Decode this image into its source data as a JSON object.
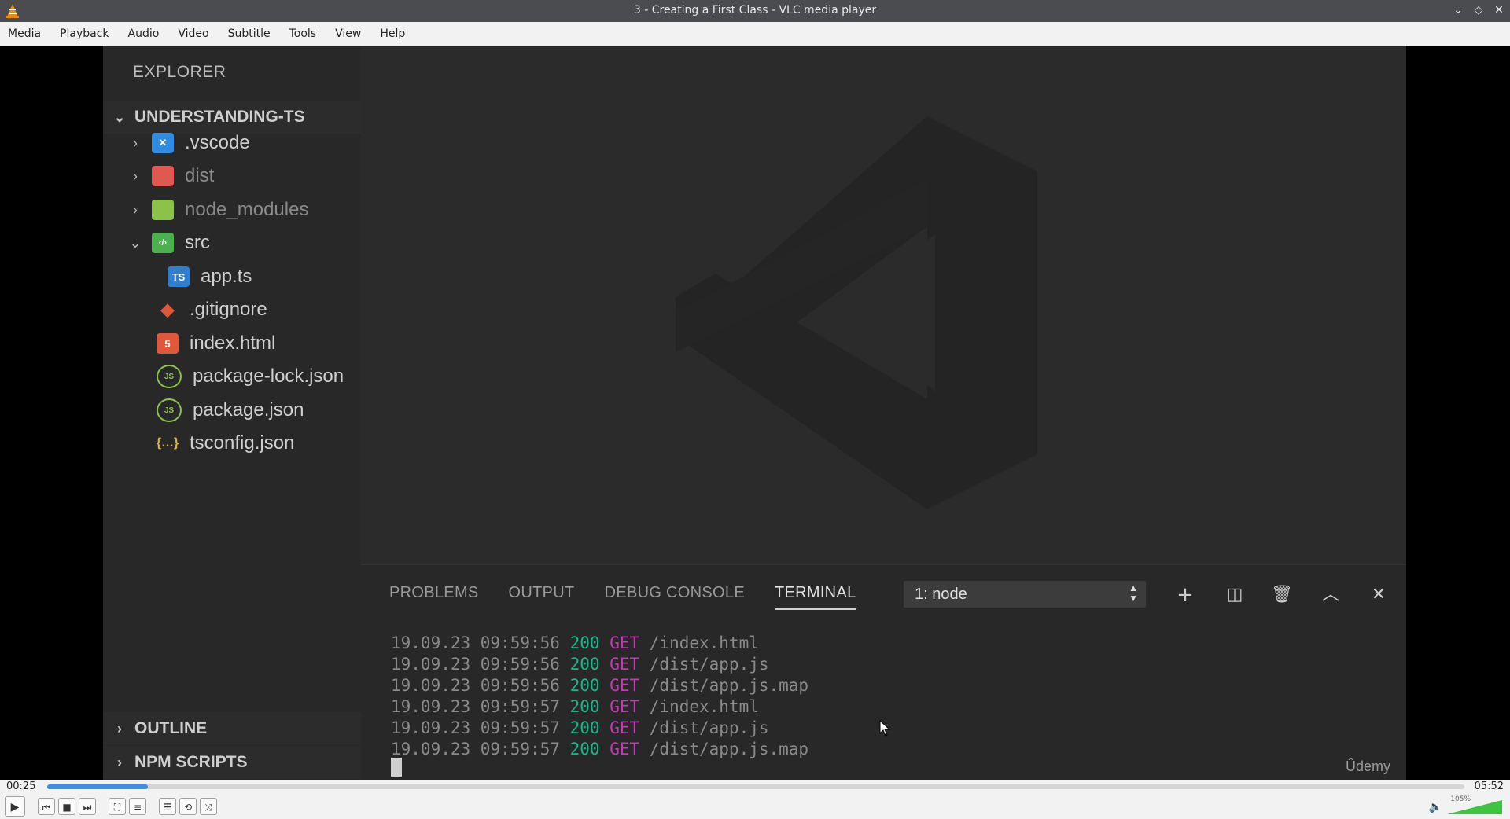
{
  "window": {
    "title": "3 - Creating a First Class - VLC media player"
  },
  "menu": [
    "Media",
    "Playback",
    "Audio",
    "Video",
    "Subtitle",
    "Tools",
    "View",
    "Help"
  ],
  "explorer": {
    "header": "EXPLORER",
    "project": "UNDERSTANDING-TS",
    "items": [
      {
        "label": ".vscode",
        "icon": "vscode-folder-icon",
        "color": "#2f8ce0",
        "glyph": "✕"
      },
      {
        "label": "dist",
        "icon": "dist-folder-icon",
        "color": "#e0584f",
        "glyph": ""
      },
      {
        "label": "node_modules",
        "icon": "node-folder-icon",
        "color": "#8bc34a",
        "glyph": ""
      },
      {
        "label": "src",
        "icon": "src-folder-icon",
        "color": "#4caf50",
        "glyph": "‹/›"
      },
      {
        "label": "app.ts",
        "icon": "typescript-file-icon",
        "color": "#2f7fd1",
        "glyph": "TS"
      },
      {
        "label": ".gitignore",
        "icon": "git-file-icon",
        "color": "#e0583a",
        "glyph": "◆"
      },
      {
        "label": "index.html",
        "icon": "html-file-icon",
        "color": "#e0583a",
        "glyph": "5"
      },
      {
        "label": "package-lock.json",
        "icon": "nodejs-file-icon",
        "color": "#8bc34a",
        "glyph": "JS"
      },
      {
        "label": "package.json",
        "icon": "nodejs-file-icon",
        "color": "#8bc34a",
        "glyph": "JS"
      },
      {
        "label": "tsconfig.json",
        "icon": "json-file-icon",
        "color": "#e0b341",
        "glyph": "{…}"
      }
    ],
    "outline": "OUTLINE",
    "npm_scripts": "NPM SCRIPTS"
  },
  "panel": {
    "tabs": [
      "PROBLEMS",
      "OUTPUT",
      "DEBUG CONSOLE",
      "TERMINAL"
    ],
    "active_tab": "TERMINAL",
    "terminal_select": "1: node",
    "log": [
      {
        "ts": "19.09.23 09:59:56",
        "code": "200",
        "method": "GET",
        "path": "/index.html"
      },
      {
        "ts": "19.09.23 09:59:56",
        "code": "200",
        "method": "GET",
        "path": "/dist/app.js"
      },
      {
        "ts": "19.09.23 09:59:56",
        "code": "200",
        "method": "GET",
        "path": "/dist/app.js.map"
      },
      {
        "ts": "19.09.23 09:59:57",
        "code": "200",
        "method": "GET",
        "path": "/index.html"
      },
      {
        "ts": "19.09.23 09:59:57",
        "code": "200",
        "method": "GET",
        "path": "/dist/app.js"
      },
      {
        "ts": "19.09.23 09:59:57",
        "code": "200",
        "method": "GET",
        "path": "/dist/app.js.map"
      }
    ],
    "watermark": "Ûdemy"
  },
  "player": {
    "elapsed": "00:25",
    "total": "05:52",
    "progress": 0.071,
    "volume_label": "105%",
    "volume": 1.05
  }
}
